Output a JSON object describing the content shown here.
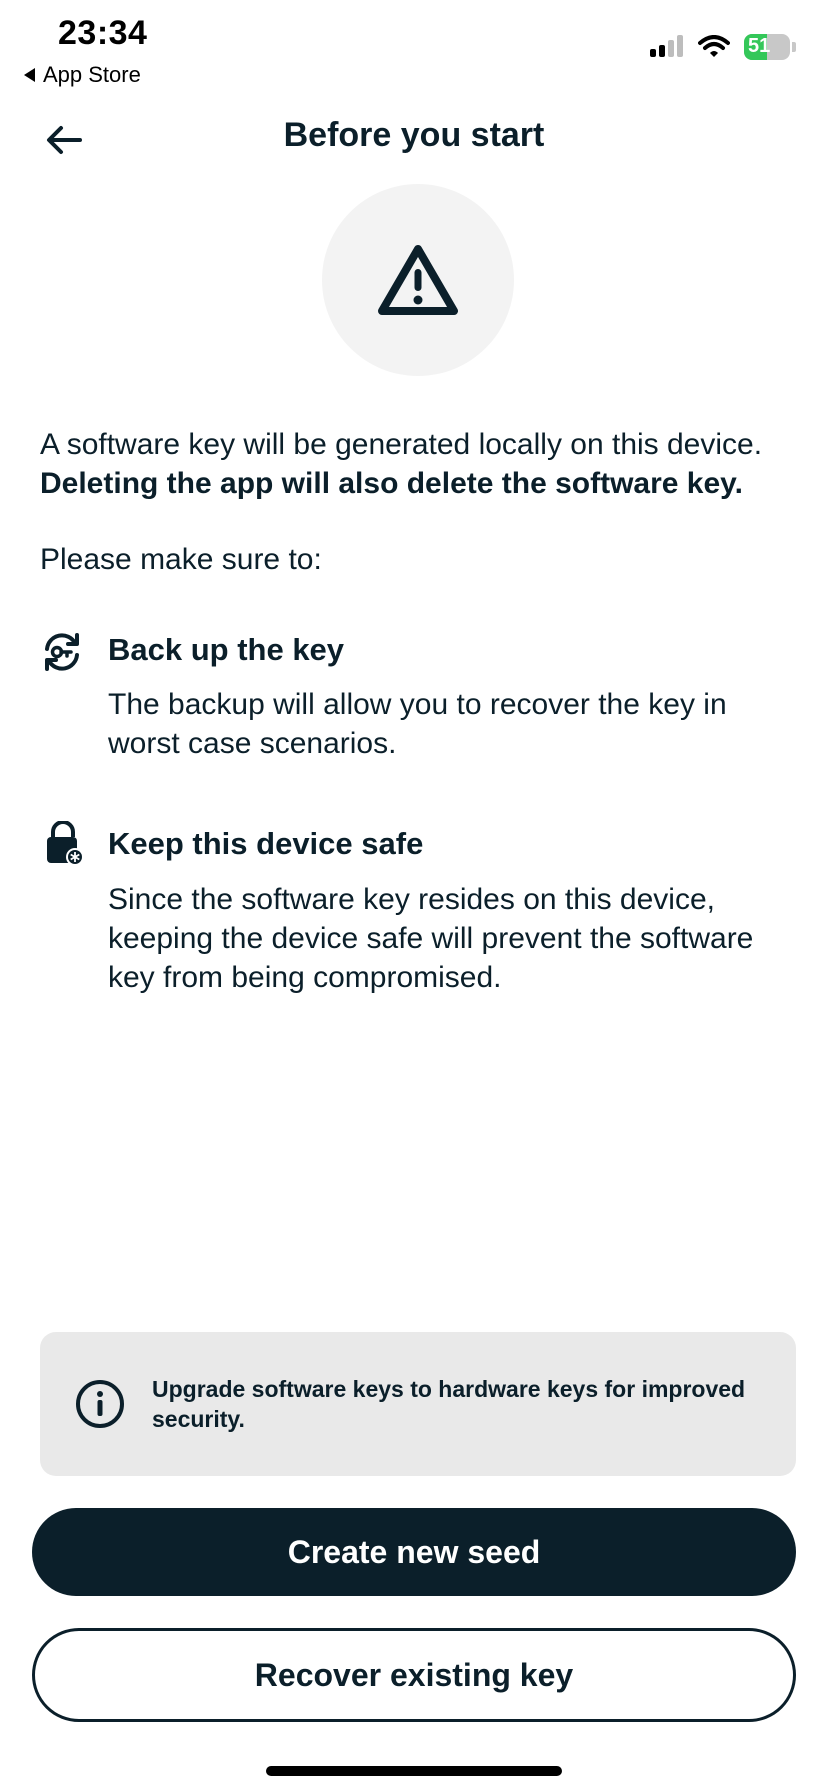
{
  "status_bar": {
    "time": "23:34",
    "back_app_label": "App Store",
    "battery_percent": "51",
    "battery_level": 0.51
  },
  "header": {
    "title": "Before you start",
    "back_icon": "arrow-left-icon"
  },
  "hero": {
    "icon": "warning-triangle-icon"
  },
  "intro": {
    "line": "A software key will be generated locally on this device.",
    "strong": "Deleting the app will also delete the software key."
  },
  "make_sure": "Please make sure to:",
  "items": [
    {
      "icon": "key-sync-icon",
      "title": "Back up the key",
      "description": "The backup will allow you to recover the key in worst case scenarios."
    },
    {
      "icon": "lock-shield-icon",
      "title": "Keep this device safe",
      "description": "Since the software key resides on this device, keeping the device safe will prevent the software key from being compromised."
    }
  ],
  "info": {
    "icon": "info-icon",
    "text": "Upgrade software keys to hardware keys for improved security."
  },
  "buttons": {
    "primary": "Create new seed",
    "secondary": "Recover existing key"
  },
  "colors": {
    "ink": "#0b1f2a",
    "battery": "#34c759",
    "info_bg": "#e9e9e9",
    "hero_bg": "#f3f3f3"
  }
}
